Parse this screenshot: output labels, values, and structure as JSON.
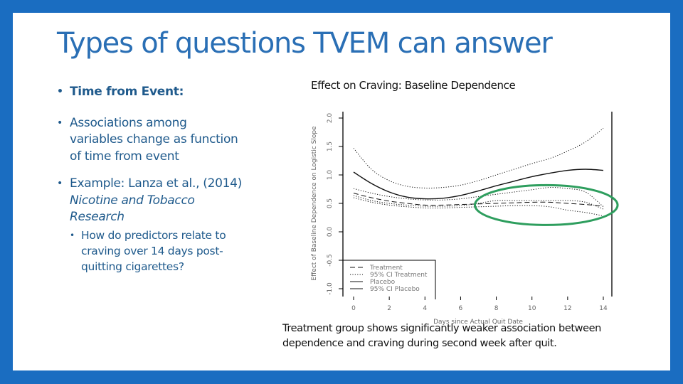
{
  "slide": {
    "title": "Types of questions TVEM can answer",
    "bullets": [
      {
        "text": "Time from Event:"
      },
      {
        "text": "Associations among variables change as function of time from event"
      },
      {
        "prefix": "Example: Lanza et al., (2014) ",
        "italic": "Nicotine and Tobacco Research"
      },
      {
        "text": "How do predictors relate to craving over 14 days post-quitting cigarettes?",
        "level": 2
      }
    ],
    "caption": "Treatment group shows significantly weaker association between dependence and craving during second week after quit.",
    "colors": {
      "frame": "#1a6dc1",
      "title": "#2a6fb5",
      "body": "#1f5a8c",
      "highlight": "#2e9e5e"
    }
  },
  "chart_data": {
    "type": "line",
    "title": "Effect on Craving: Baseline Dependence",
    "xlabel": "Days since Actual Quit Date",
    "ylabel": "Effect of Baseline Dependence on Logistic Slope",
    "xlim": [
      0,
      14
    ],
    "ylim": [
      -1.0,
      2.0
    ],
    "xticks": [
      0,
      2,
      4,
      6,
      8,
      10,
      12,
      14
    ],
    "yticks": [
      -1.0,
      -0.5,
      0.0,
      0.5,
      1.0,
      1.5,
      2.0
    ],
    "ytick_labels": [
      "-1.0",
      "-0.5",
      "0.0",
      "0.5",
      "1.0",
      "1.5",
      "2.0"
    ],
    "grid": false,
    "legend_position": "bottom-left",
    "x": [
      0,
      1,
      2,
      3,
      4,
      5,
      6,
      7,
      8,
      9,
      10,
      11,
      12,
      13,
      14
    ],
    "series": [
      {
        "name": "Treatment",
        "style": "dashed",
        "values": [
          0.68,
          0.6,
          0.54,
          0.5,
          0.47,
          0.47,
          0.48,
          0.49,
          0.5,
          0.51,
          0.52,
          0.52,
          0.5,
          0.48,
          0.45
        ]
      },
      {
        "name": "95% CI Treatment",
        "style": "dotted",
        "values": [
          0.76,
          0.68,
          0.62,
          0.58,
          0.56,
          0.56,
          0.58,
          0.62,
          0.66,
          0.7,
          0.74,
          0.78,
          0.76,
          0.7,
          0.44
        ]
      },
      {
        "name": "95% CI Treatment (lower)",
        "style": "dotted",
        "values": [
          0.6,
          0.52,
          0.47,
          0.44,
          0.42,
          0.42,
          0.43,
          0.44,
          0.45,
          0.46,
          0.46,
          0.44,
          0.38,
          0.34,
          0.28
        ]
      },
      {
        "name": "Placebo",
        "style": "solid",
        "values": [
          1.05,
          0.85,
          0.7,
          0.61,
          0.58,
          0.59,
          0.64,
          0.72,
          0.81,
          0.89,
          0.97,
          1.03,
          1.08,
          1.1,
          1.08
        ]
      },
      {
        "name": "95% CI Placebo",
        "style": "dotted",
        "values": [
          1.47,
          1.1,
          0.9,
          0.8,
          0.77,
          0.78,
          0.82,
          0.9,
          1.0,
          1.1,
          1.2,
          1.29,
          1.42,
          1.58,
          1.82
        ]
      },
      {
        "name": "95% CI Placebo (lower)",
        "style": "dotted",
        "values": [
          0.64,
          0.55,
          0.5,
          0.47,
          0.45,
          0.45,
          0.46,
          0.5,
          0.55,
          0.55,
          0.55,
          0.55,
          0.55,
          0.52,
          0.4
        ]
      }
    ],
    "legend": [
      "Treatment",
      "95% CI Treatment",
      "Placebo",
      "95% CI Placebo"
    ],
    "annotation": {
      "type": "ellipse",
      "x_range": [
        6.8,
        14.8
      ],
      "y_range": [
        0.12,
        0.82
      ],
      "color": "#2e9e5e"
    }
  }
}
